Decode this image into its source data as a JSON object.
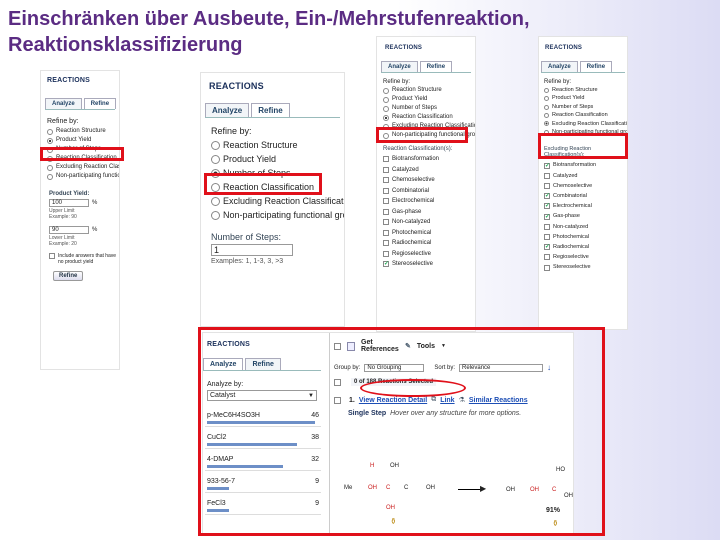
{
  "slide": {
    "title_line1": "Einschränken über Ausbeute, Ein-/Mehrstufenreaktion,",
    "title_line2": "Reaktionsklassifizierung"
  },
  "common": {
    "header": "REACTIONS",
    "tab_analyze": "Analyze",
    "tab_refine": "Refine",
    "refine_by": "Refine by:"
  },
  "panel1": {
    "options": [
      {
        "label": "Reaction Structure",
        "selected": false
      },
      {
        "label": "Product Yield",
        "selected": true
      },
      {
        "label": "Number of Steps",
        "selected": false
      },
      {
        "label": "Reaction Classification",
        "selected": false
      },
      {
        "label": "Excluding Reaction Classification",
        "selected": false
      },
      {
        "label": "Non-participating functional groups",
        "selected": false
      }
    ],
    "yield_heading": "Product Yield:",
    "upper_value": "100",
    "upper_unit": "%",
    "upper_label": "Upper Limit",
    "upper_example": "Example: 90",
    "lower_value": "90",
    "lower_unit": "%",
    "lower_label": "Lower Limit",
    "lower_example": "Example: 20",
    "include_text": "Include answers that have no product yield",
    "refine_button": "Refine"
  },
  "panel2": {
    "options": [
      {
        "label": "Reaction Structure",
        "selected": false
      },
      {
        "label": "Product Yield",
        "selected": false
      },
      {
        "label": "Number of Steps",
        "selected": true
      },
      {
        "label": "Reaction Classification",
        "selected": false
      },
      {
        "label": "Excluding Reaction Classification",
        "selected": false
      },
      {
        "label": "Non-participating functional groups",
        "selected": false
      }
    ],
    "steps_heading": "Number of Steps:",
    "steps_value": "1",
    "steps_example": "Examples: 1, 1-3, 3, >3"
  },
  "panel3": {
    "options": [
      {
        "label": "Reaction Structure",
        "selected": false
      },
      {
        "label": "Product Yield",
        "selected": false
      },
      {
        "label": "Number of Steps",
        "selected": false
      },
      {
        "label": "Reaction Classification",
        "selected": true
      },
      {
        "label": "Excluding Reaction Classification",
        "selected": false
      },
      {
        "label": "Non-participating functional groups",
        "selected": false
      }
    ],
    "class_heading": "Reaction Classification(s):",
    "classes": [
      {
        "label": "Biotransformation",
        "checked": false
      },
      {
        "label": "Catalyzed",
        "checked": false
      },
      {
        "label": "Chemoselective",
        "checked": false
      },
      {
        "label": "Combinatorial",
        "checked": false
      },
      {
        "label": "Electrochemical",
        "checked": false
      },
      {
        "label": "Gas-phase",
        "checked": false
      },
      {
        "label": "Non-catalyzed",
        "checked": false
      },
      {
        "label": "Photochemical",
        "checked": false
      },
      {
        "label": "Radiochemical",
        "checked": false
      },
      {
        "label": "Regioselective",
        "checked": false
      },
      {
        "label": "Stereoselective",
        "checked": true
      }
    ]
  },
  "panel4": {
    "options": [
      {
        "label": "Reaction Structure",
        "selected": false
      },
      {
        "label": "Product Yield",
        "selected": false
      },
      {
        "label": "Number of Steps",
        "selected": false
      },
      {
        "label": "Reaction Classification",
        "selected": false
      },
      {
        "label": "Excluding Reaction Classification",
        "selected": true
      },
      {
        "label": "Non-participating functional groups",
        "selected": false
      }
    ],
    "excl_heading": "Excluding Reaction Classification(s):",
    "classes": [
      {
        "label": "Biotransformation",
        "checked": true
      },
      {
        "label": "Catalyzed",
        "checked": false
      },
      {
        "label": "Chemoselective",
        "checked": false
      },
      {
        "label": "Combinatorial",
        "checked": true
      },
      {
        "label": "Electrochemical",
        "checked": true
      },
      {
        "label": "Gas-phase",
        "checked": true
      },
      {
        "label": "Non-catalyzed",
        "checked": false
      },
      {
        "label": "Photochemical",
        "checked": false
      },
      {
        "label": "Radiochemical",
        "checked": true
      },
      {
        "label": "Regioselective",
        "checked": false
      },
      {
        "label": "Stereoselective",
        "checked": false
      }
    ]
  },
  "panel5": {
    "analyze_by": "Analyze by:",
    "analyze_select": "Catalyst",
    "analysis_rows": [
      {
        "label": "p-MeC6H4SO3H",
        "count": "46",
        "fraction": 1.0
      },
      {
        "label": "CuCl2",
        "count": "38",
        "fraction": 0.83
      },
      {
        "label": "4-DMAP",
        "count": "32",
        "fraction": 0.7
      },
      {
        "label": "933-56-7",
        "count": "9",
        "fraction": 0.2
      },
      {
        "label": "FeCl3",
        "count": "9",
        "fraction": 0.2
      }
    ],
    "get_references": "Get References",
    "tools": "Tools",
    "group_by_label": "Group by:",
    "group_by_value": "No Grouping",
    "sort_by_label": "Sort by:",
    "sort_by_value": "Relevance",
    "selected_text": "0 of 188 Reactions Selected",
    "result_number": "1.",
    "view_detail": "View Reaction Detail",
    "link_label": "Link",
    "similar_reactions": "Similar Reactions",
    "single_step": "Single Step",
    "hover_text": "Hover over any structure for more options.",
    "yield_value": "91%",
    "structure_labels": {
      "me_left": "Me",
      "h": "H",
      "oh_top": "OH",
      "oh_mid": "OH",
      "c_mid": "C",
      "oh_right": "OH",
      "oh_bottom": "OH",
      "oh_p1": "OH",
      "oh_p2": "OH",
      "c_p": "C",
      "oh_p3": "OH",
      "ho_top": "HO"
    }
  },
  "colors": {
    "title": "#5b2c83",
    "highlight_red": "#e0101a",
    "header_navy": "#1a2f5a",
    "link_blue": "#1c4eb5"
  }
}
